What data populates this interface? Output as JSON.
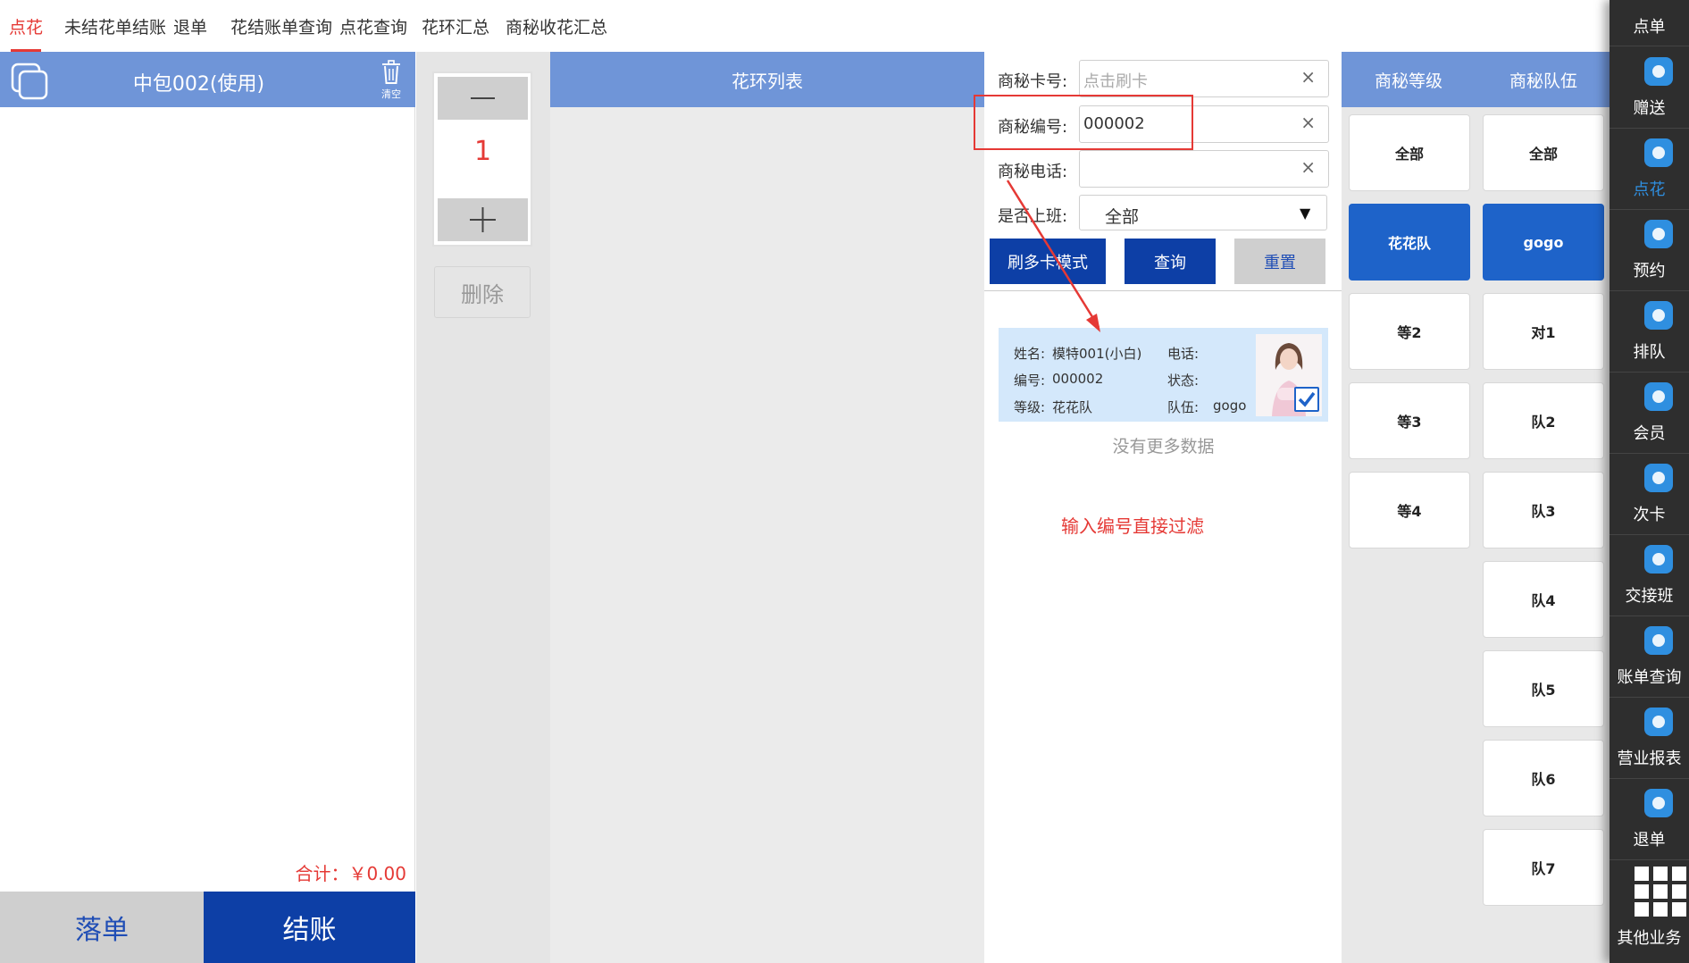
{
  "top_tabs": [
    "点花",
    "未结花单结账",
    "退单",
    "花结账单查询",
    "点花查询",
    "花环汇总",
    "商秘收花汇总"
  ],
  "active_tab": "点花",
  "order": {
    "room_title": "中包002(使用)",
    "clear_label": "清空",
    "total_label": "合计：￥0.00",
    "place_order_label": "落单",
    "checkout_label": "结账"
  },
  "quantity": {
    "value": "1",
    "delete_label": "删除"
  },
  "flower_list": {
    "header": "花环列表"
  },
  "filter": {
    "card_label": "商秘卡号:",
    "card_placeholder": "点击刷卡",
    "code_label": "商秘编号:",
    "code_value": "000002",
    "phone_label": "商秘电话:",
    "phone_value": "",
    "on_duty_label": "是否上班:",
    "on_duty_value": "全部",
    "clear_symbol": "×",
    "dropdown_symbol": "▼",
    "swipe_multi_label": "刷多卡模式",
    "query_label": "查询",
    "reset_label": "重置"
  },
  "staff_card": {
    "name_label": "姓名:",
    "name_value": "模特001(小白)",
    "phone_label": "电话:",
    "code_label": "编号:",
    "code_value": "000002",
    "status_label": "状态:",
    "level_label": "等级:",
    "level_value": "花花队",
    "team_label": "队伍:",
    "team_value": "gogo",
    "selected": true
  },
  "no_more_text": "没有更多数据",
  "annotation_text": "输入编号直接过滤",
  "levels": {
    "header": "商秘等级",
    "items": [
      "全部",
      "花花队",
      "等2",
      "等3",
      "等4"
    ],
    "selected": "花花队"
  },
  "teams": {
    "header": "商秘队伍",
    "items": [
      "全部",
      "gogo",
      "对1",
      "队2",
      "队3",
      "队4",
      "队5",
      "队6",
      "队7"
    ],
    "selected": "gogo"
  },
  "sidebar": {
    "items": [
      {
        "label": "点单",
        "icon": "order-icon"
      },
      {
        "label": "赠送",
        "icon": "gift-icon"
      },
      {
        "label": "点花",
        "icon": "flower-icon",
        "active": true
      },
      {
        "label": "预约",
        "icon": "reservation-icon"
      },
      {
        "label": "排队",
        "icon": "queue-icon"
      },
      {
        "label": "会员",
        "icon": "member-icon"
      },
      {
        "label": "次卡",
        "icon": "count-card-icon"
      },
      {
        "label": "交接班",
        "icon": "shift-handover-icon"
      },
      {
        "label": "账单查询",
        "icon": "bill-query-icon"
      },
      {
        "label": "营业报表",
        "icon": "report-icon"
      },
      {
        "label": "退单",
        "icon": "refund-icon"
      }
    ],
    "more_label": "其他业务"
  },
  "colors": {
    "header_blue": "#6f95d8",
    "primary_blue": "#0d3fa6",
    "selected_blue": "#1e63c9",
    "alert_red": "#e53935",
    "sidebar_dark": "#2e2e2e"
  }
}
